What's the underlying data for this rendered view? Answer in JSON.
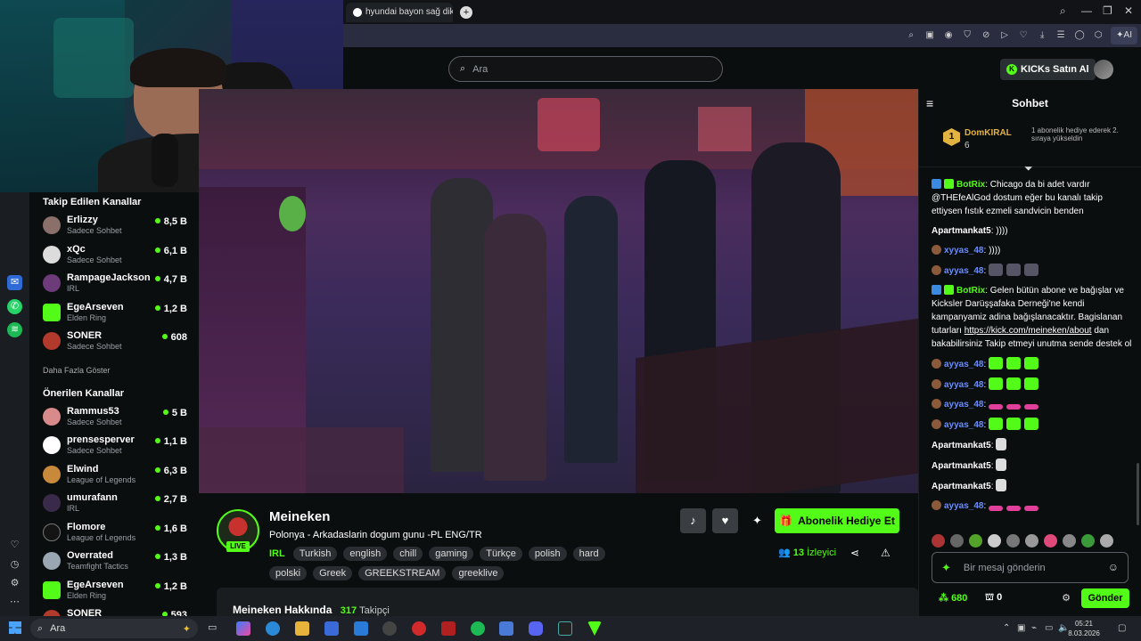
{
  "browser": {
    "tab_title": "hyundai bayon sağ dikiz ayna",
    "ai_label": "AI"
  },
  "header": {
    "search_placeholder": "Ara",
    "kicks_button": "KICKs Satın Al"
  },
  "sidebar": {
    "followed_title": "Takip Edilen Kanallar",
    "followed": [
      {
        "name": "Erlizzy",
        "category": "Sadece Sohbet",
        "viewers": "8,5 B"
      },
      {
        "name": "xQc",
        "category": "Sadece Sohbet",
        "viewers": "6,1 B"
      },
      {
        "name": "RampageJackson",
        "category": "IRL",
        "viewers": "4,7 B"
      },
      {
        "name": "EgeArseven",
        "category": "Elden Ring",
        "viewers": "1,2 B"
      },
      {
        "name": "SONER",
        "category": "Sadece Sohbet",
        "viewers": "608"
      }
    ],
    "show_more": "Daha Fazla Göster",
    "recommended_title": "Önerilen Kanallar",
    "recommended": [
      {
        "name": "Rammus53",
        "category": "Sadece Sohbet",
        "viewers": "5 B"
      },
      {
        "name": "prensesperver",
        "category": "Sadece Sohbet",
        "viewers": "1,1 B"
      },
      {
        "name": "Elwind",
        "category": "League of Legends",
        "viewers": "6,3 B"
      },
      {
        "name": "umurafann",
        "category": "IRL",
        "viewers": "2,7 B"
      },
      {
        "name": "Flomore",
        "category": "League of Legends",
        "viewers": "1,6 B"
      },
      {
        "name": "Overrated",
        "category": "Teamfight Tactics",
        "viewers": "1,3 B"
      },
      {
        "name": "EgeArseven",
        "category": "Elden Ring",
        "viewers": "1,2 B"
      },
      {
        "name": "SONER",
        "category": "",
        "viewers": "593"
      }
    ]
  },
  "stream": {
    "streamer": "Meineken",
    "live_label": "LIVE",
    "title": "Polonya - Arkadaslarin dogum gunu -PL ENG/TR",
    "category": "IRL",
    "tags": [
      "Turkish",
      "english",
      "chill",
      "gaming",
      "Türkçe",
      "polish",
      "hard",
      "polski",
      "Greek",
      "GREEKSTREAM",
      "greeklive"
    ],
    "gift_button": "Abonelik Hediye Et",
    "viewer_count": "13",
    "viewer_label": "İzleyici",
    "about_title": "Meineken Hakkında",
    "followers_count": "317",
    "followers_label": "Takipçi"
  },
  "chat": {
    "title": "Sohbet",
    "pinned": {
      "user": "DomKIRAL",
      "count": "6",
      "rank": "1",
      "description": "1 abonelik hediye ederek 2. sıraya yükseldin"
    },
    "messages": [
      {
        "user": "BotRix",
        "text": "Chicago da bi adet vardır @THEfeAlGod dostum eğer bu kanalı takip ettiysen fıstık ezmeli sandvicin benden",
        "color": "#53fc18"
      },
      {
        "user": "Apartmankat5",
        "text": "))))",
        "color": "#ffffff"
      },
      {
        "user": "xyyas_48",
        "text": "))))",
        "color": "#6a8dff"
      },
      {
        "user": "ayyas_48",
        "text": "",
        "color": "#6a8dff"
      },
      {
        "user": "BotRix",
        "text": "Gelen bütün abone ve bağışlar ve Kicksler Darüşşafaka Derneği'ne kendi kampanyamiz adina bağışlanacaktır. Bagislanan tutarları",
        "link": "https://kick.com/meineken/about",
        "text2": "dan bakabilirsiniz Takip etmeyi unutma sende destek ol",
        "color": "#53fc18"
      },
      {
        "user": "ayyas_48",
        "text": "",
        "color": "#6a8dff"
      },
      {
        "user": "ayyas_48",
        "text": "",
        "color": "#6a8dff"
      },
      {
        "user": "ayyas_48",
        "text": "",
        "color": "#6a8dff"
      },
      {
        "user": "ayyas_48",
        "text": "",
        "color": "#6a8dff"
      },
      {
        "user": "Apartmankat5",
        "text": "",
        "color": "#ffffff"
      },
      {
        "user": "Apartmankat5",
        "text": "",
        "color": "#ffffff"
      },
      {
        "user": "Apartmankat5",
        "text": "",
        "color": "#ffffff"
      },
      {
        "user": "ayyas_48",
        "text": "",
        "color": "#6a8dff"
      }
    ],
    "input_placeholder": "Bir mesaj gönderin",
    "points": "680",
    "points2": "0",
    "send_button": "Gönder"
  },
  "taskbar": {
    "search": "Ara",
    "time": "05:21",
    "date": "8.03.2026"
  },
  "colors": {
    "accent": "#53fc18",
    "background": "#0b0e0f",
    "user_blue": "#6a8dff"
  }
}
